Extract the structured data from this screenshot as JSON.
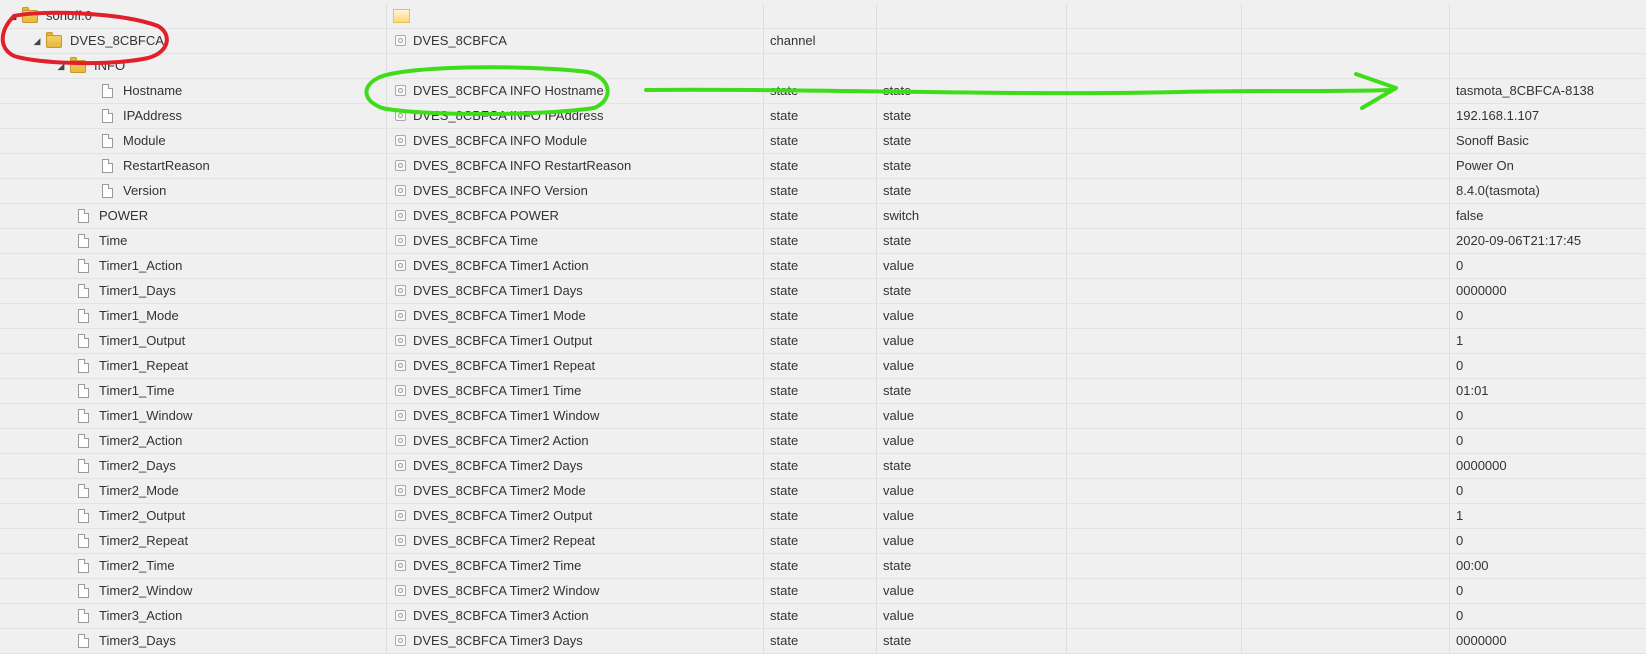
{
  "rows": [
    {
      "level": 0,
      "kind": "folder",
      "expanded": true,
      "name": "sonoff.0",
      "label": "",
      "type": "",
      "role": "",
      "value": "",
      "adapter_logo": true
    },
    {
      "level": 1,
      "kind": "folder",
      "expanded": true,
      "name": "DVES_8CBFCA",
      "label": "DVES_8CBFCA",
      "type": "channel",
      "role": "",
      "value": ""
    },
    {
      "level": 2,
      "kind": "folder",
      "expanded": true,
      "name": "INFO",
      "label": "",
      "type": "",
      "role": "",
      "value": ""
    },
    {
      "level": 3,
      "kind": "file",
      "name": "Hostname",
      "label": "DVES_8CBFCA INFO Hostname",
      "type": "state",
      "role": "state",
      "value": "tasmota_8CBFCA-8138"
    },
    {
      "level": 3,
      "kind": "file",
      "name": "IPAddress",
      "label": "DVES_8CBFCA INFO IPAddress",
      "type": "state",
      "role": "state",
      "value": "192.168.1.107"
    },
    {
      "level": 3,
      "kind": "file",
      "name": "Module",
      "label": "DVES_8CBFCA INFO Module",
      "type": "state",
      "role": "state",
      "value": "Sonoff Basic"
    },
    {
      "level": 3,
      "kind": "file",
      "name": "RestartReason",
      "label": "DVES_8CBFCA INFO RestartReason",
      "type": "state",
      "role": "state",
      "value": "Power On"
    },
    {
      "level": 3,
      "kind": "file",
      "name": "Version",
      "label": "DVES_8CBFCA INFO Version",
      "type": "state",
      "role": "state",
      "value": "8.4.0(tasmota)"
    },
    {
      "level": 2,
      "kind": "file",
      "name": "POWER",
      "label": "DVES_8CBFCA POWER",
      "type": "state",
      "role": "switch",
      "value": "false"
    },
    {
      "level": 2,
      "kind": "file",
      "name": "Time",
      "label": "DVES_8CBFCA Time",
      "type": "state",
      "role": "state",
      "value": "2020-09-06T21:17:45"
    },
    {
      "level": 2,
      "kind": "file",
      "name": "Timer1_Action",
      "label": "DVES_8CBFCA Timer1 Action",
      "type": "state",
      "role": "value",
      "value": "0"
    },
    {
      "level": 2,
      "kind": "file",
      "name": "Timer1_Days",
      "label": "DVES_8CBFCA Timer1 Days",
      "type": "state",
      "role": "state",
      "value": "0000000"
    },
    {
      "level": 2,
      "kind": "file",
      "name": "Timer1_Mode",
      "label": "DVES_8CBFCA Timer1 Mode",
      "type": "state",
      "role": "value",
      "value": "0"
    },
    {
      "level": 2,
      "kind": "file",
      "name": "Timer1_Output",
      "label": "DVES_8CBFCA Timer1 Output",
      "type": "state",
      "role": "value",
      "value": "1"
    },
    {
      "level": 2,
      "kind": "file",
      "name": "Timer1_Repeat",
      "label": "DVES_8CBFCA Timer1 Repeat",
      "type": "state",
      "role": "value",
      "value": "0"
    },
    {
      "level": 2,
      "kind": "file",
      "name": "Timer1_Time",
      "label": "DVES_8CBFCA Timer1 Time",
      "type": "state",
      "role": "state",
      "value": "01:01"
    },
    {
      "level": 2,
      "kind": "file",
      "name": "Timer1_Window",
      "label": "DVES_8CBFCA Timer1 Window",
      "type": "state",
      "role": "value",
      "value": "0"
    },
    {
      "level": 2,
      "kind": "file",
      "name": "Timer2_Action",
      "label": "DVES_8CBFCA Timer2 Action",
      "type": "state",
      "role": "value",
      "value": "0"
    },
    {
      "level": 2,
      "kind": "file",
      "name": "Timer2_Days",
      "label": "DVES_8CBFCA Timer2 Days",
      "type": "state",
      "role": "state",
      "value": "0000000"
    },
    {
      "level": 2,
      "kind": "file",
      "name": "Timer2_Mode",
      "label": "DVES_8CBFCA Timer2 Mode",
      "type": "state",
      "role": "value",
      "value": "0"
    },
    {
      "level": 2,
      "kind": "file",
      "name": "Timer2_Output",
      "label": "DVES_8CBFCA Timer2 Output",
      "type": "state",
      "role": "value",
      "value": "1"
    },
    {
      "level": 2,
      "kind": "file",
      "name": "Timer2_Repeat",
      "label": "DVES_8CBFCA Timer2 Repeat",
      "type": "state",
      "role": "value",
      "value": "0"
    },
    {
      "level": 2,
      "kind": "file",
      "name": "Timer2_Time",
      "label": "DVES_8CBFCA Timer2 Time",
      "type": "state",
      "role": "state",
      "value": "00:00"
    },
    {
      "level": 2,
      "kind": "file",
      "name": "Timer2_Window",
      "label": "DVES_8CBFCA Timer2 Window",
      "type": "state",
      "role": "value",
      "value": "0"
    },
    {
      "level": 2,
      "kind": "file",
      "name": "Timer3_Action",
      "label": "DVES_8CBFCA Timer3 Action",
      "type": "state",
      "role": "value",
      "value": "0"
    },
    {
      "level": 2,
      "kind": "file",
      "name": "Timer3_Days",
      "label": "DVES_8CBFCA Timer3 Days",
      "type": "state",
      "role": "state",
      "value": "0000000"
    }
  ],
  "annotation_colors": {
    "red": "#e0202a",
    "green": "#3fdc1a"
  }
}
